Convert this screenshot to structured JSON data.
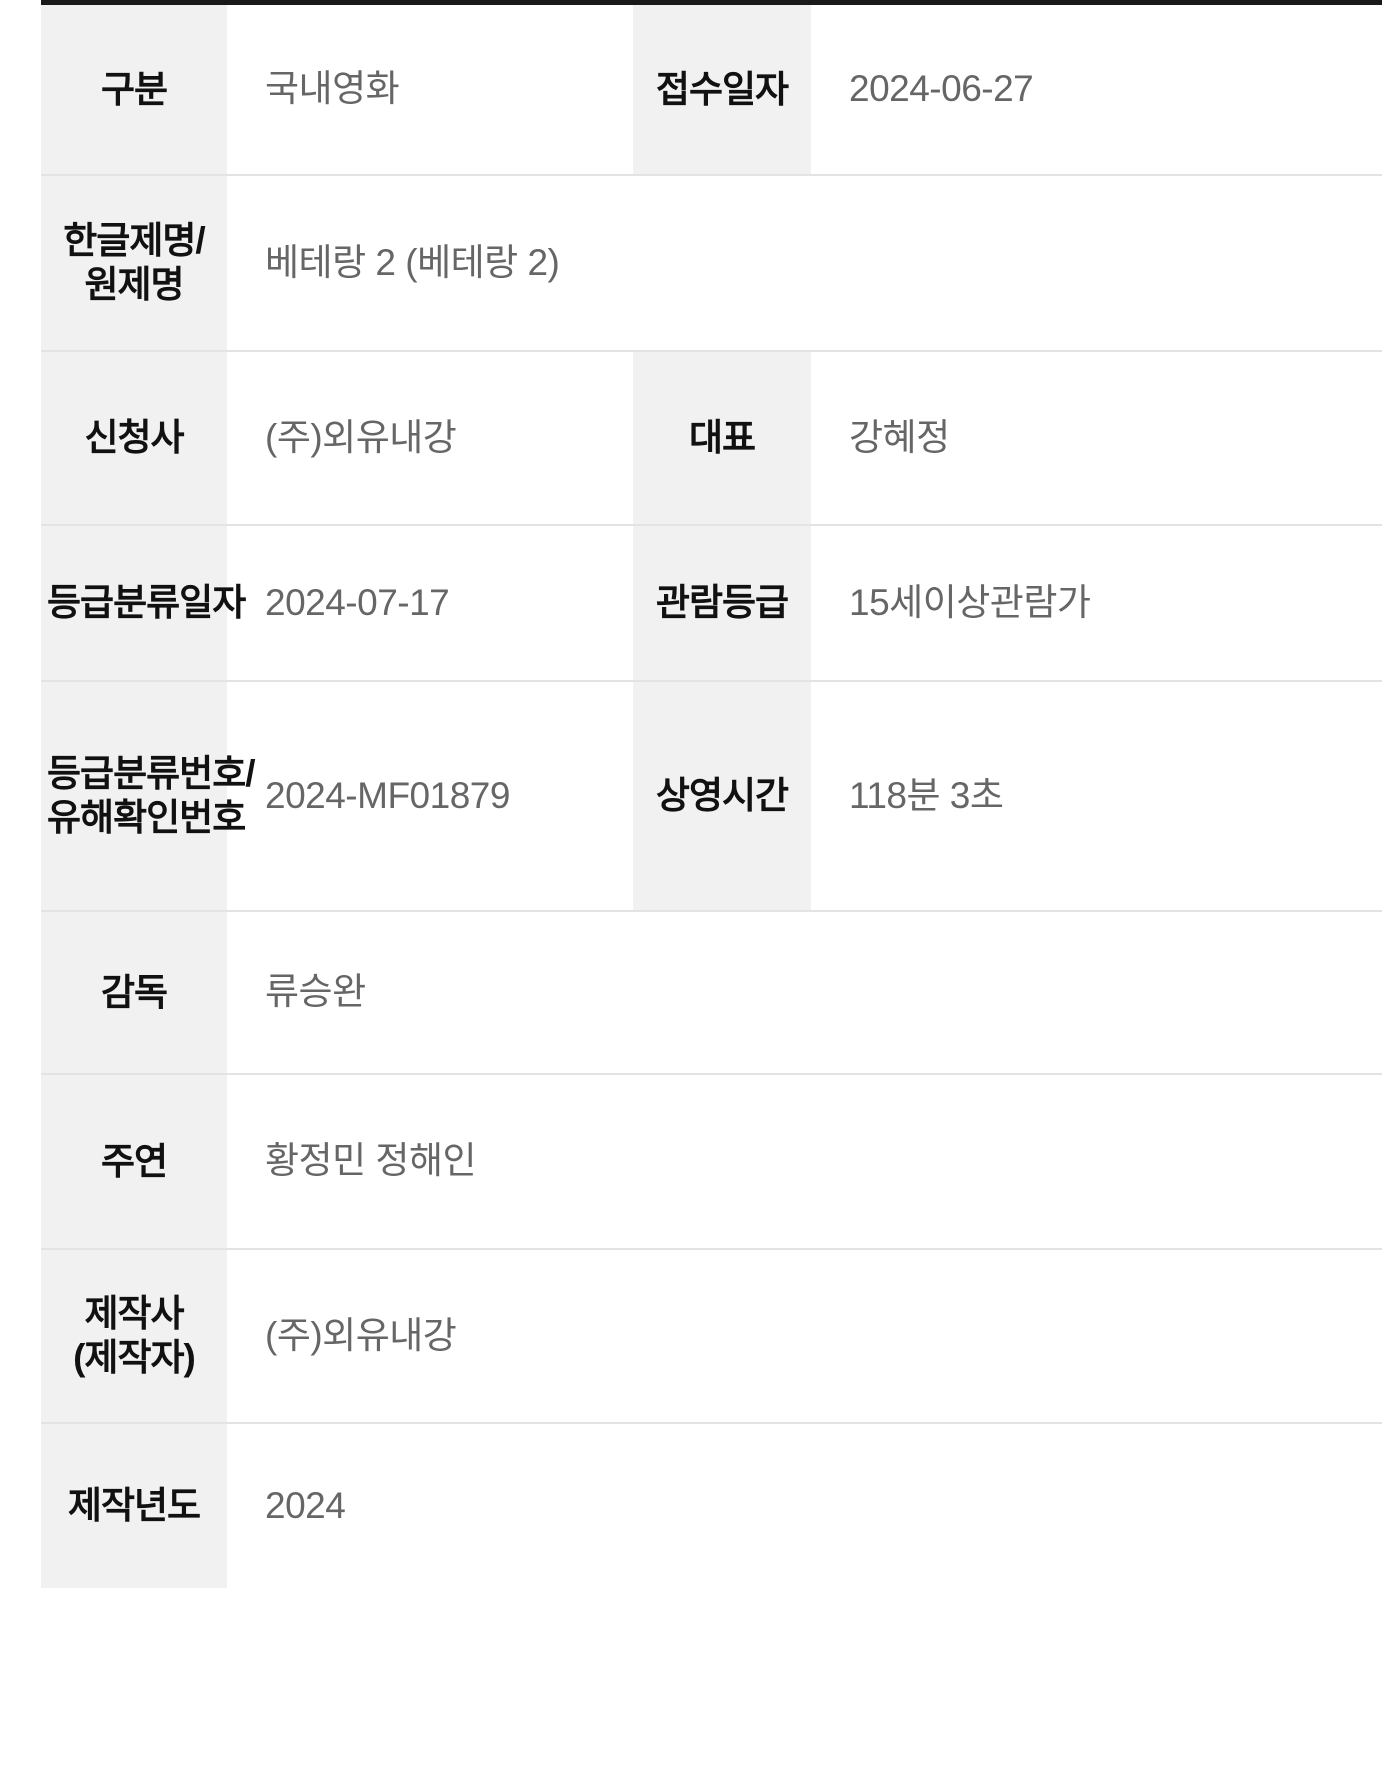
{
  "table": {
    "rows": [
      {
        "label1": "구분",
        "value1": "국내영화",
        "label2": "접수일자",
        "value2": "2024-06-27"
      },
      {
        "label1": "한글제명/원제명",
        "value1": "베테랑 2  (베테랑 2)",
        "label2": "",
        "value2": ""
      },
      {
        "label1": "신청사",
        "value1": "(주)외유내강",
        "label2": "대표",
        "value2": "강혜정"
      },
      {
        "label1": "등급분류일자",
        "value1": "2024-07-17",
        "label2": "관람등급",
        "value2": "15세이상관람가"
      },
      {
        "label1": "등급분류번호/유해확인번호",
        "value1": "2024-MF01879",
        "label2": "상영시간",
        "value2": "118분 3초"
      },
      {
        "label1": "감독",
        "value1": "류승완",
        "label2": "",
        "value2": ""
      },
      {
        "label1": "주연",
        "value1": "황정민 정해인",
        "label2": "",
        "value2": ""
      },
      {
        "label1": "제작사(제작자)",
        "value1": "(주)외유내강",
        "label2": "",
        "value2": ""
      },
      {
        "label1": "제작년도",
        "value1": "2024",
        "label2": "",
        "value2": ""
      }
    ]
  },
  "colors": {
    "label_background": "#f1f1f1",
    "label_text": "#111111",
    "value_text": "#666666",
    "top_border": "#1a1a1a",
    "row_border": "#e3e3e3"
  }
}
